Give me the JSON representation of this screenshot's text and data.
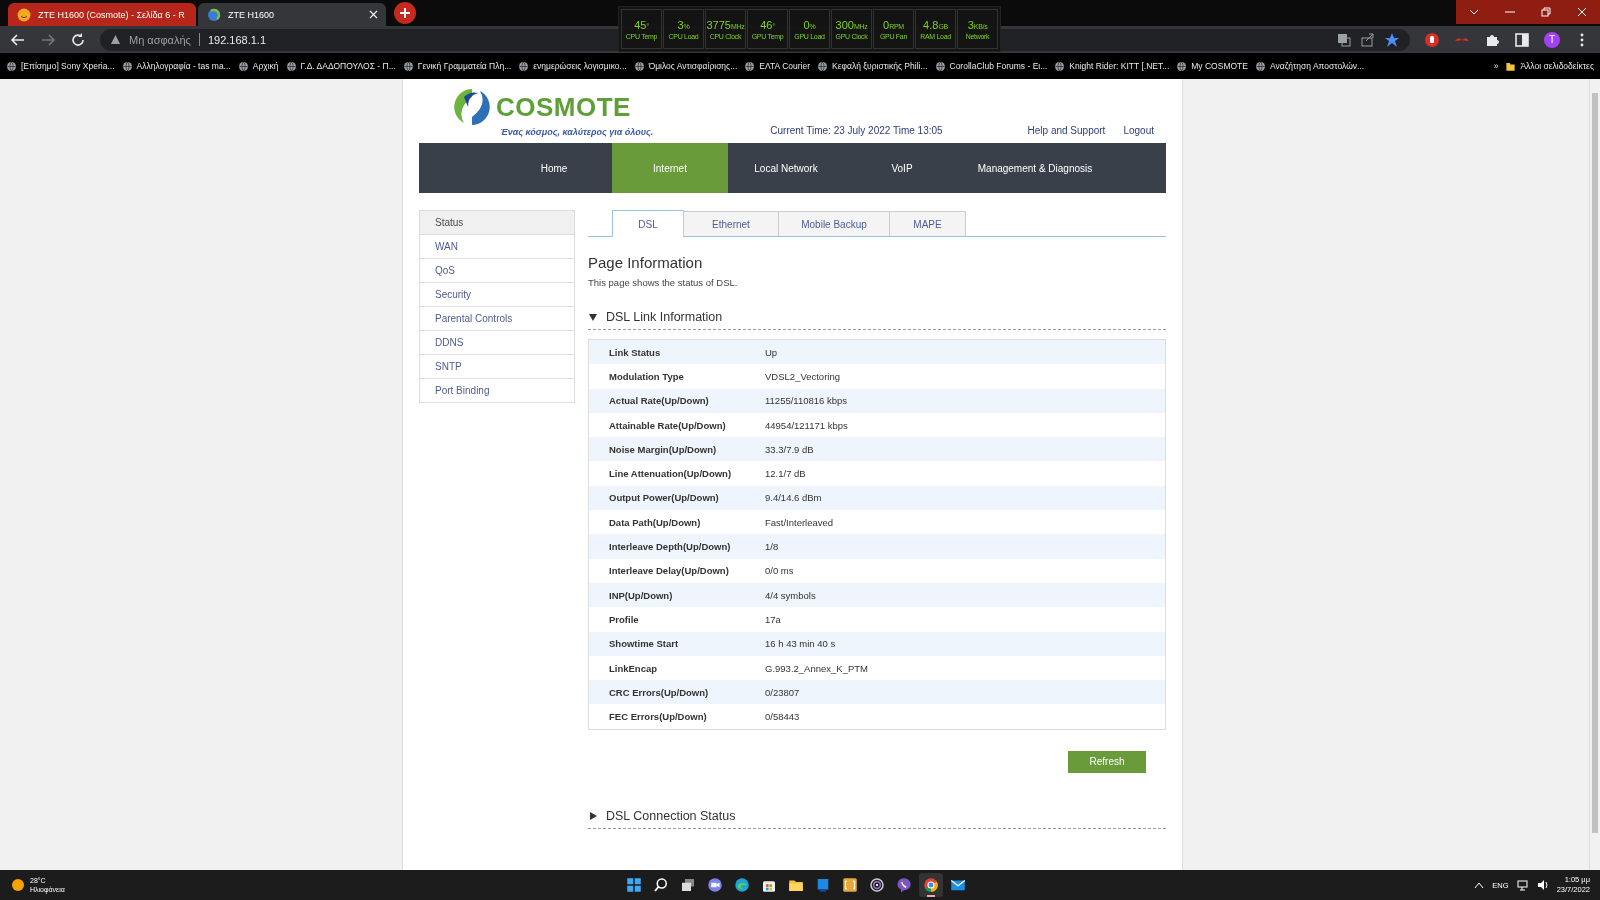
{
  "browser": {
    "tabs": [
      {
        "title": "ZTE H1600 (Cosmote) - Σελίδα 6 - R",
        "selected": false,
        "kind": "forum"
      },
      {
        "title": "ZTE H1600",
        "selected": true,
        "kind": "router"
      }
    ],
    "address": {
      "security": "Μη ασφαλής",
      "url": "192.168.1.1"
    },
    "bookmarks": [
      {
        "label": "[Επίσημο] Sony Xperia..."
      },
      {
        "label": "Αλληλογραφία - tas ma..."
      },
      {
        "label": "Αρχική"
      },
      {
        "label": "Γ.Δ. ΔΑΔΟΠΟΥΛΟΣ - Π..."
      },
      {
        "label": "Γενική Γραμματεία Πλη..."
      },
      {
        "label": "ενημερώσεις λογισμικο..."
      },
      {
        "label": "Όμιλος Αντισφαίρισης..."
      },
      {
        "label": "ΕΛΤΑ Courier"
      },
      {
        "label": "Κεφαλή ξυριστικής Phili..."
      },
      {
        "label": "CorollaClub Forums - Ει..."
      },
      {
        "label": "Knight Rider: KITT [.NET..."
      },
      {
        "label": "My COSMOTE"
      },
      {
        "label": "Αναζήτηση Αποστολών..."
      }
    ],
    "overflow": "»",
    "other_bookmarks": "Άλλοι σελιδοδείκτες",
    "profile_initial": "T"
  },
  "hw_monitor": [
    {
      "value": "45",
      "unit": "°",
      "label": "CPU Temp"
    },
    {
      "value": "3",
      "unit": "%",
      "label": "CPU Load"
    },
    {
      "value": "3775",
      "unit": "MHz",
      "label": "CPU Clock"
    },
    {
      "value": "46",
      "unit": "°",
      "label": "GPU Temp"
    },
    {
      "value": "0",
      "unit": "%",
      "label": "GPU Load"
    },
    {
      "value": "300",
      "unit": "MHz",
      "label": "GPU Clock"
    },
    {
      "value": "0",
      "unit": "RPM",
      "label": "GPU Fan"
    },
    {
      "value": "4.8",
      "unit": "GB",
      "label": "RAM Load"
    },
    {
      "value": "3",
      "unit": "KB/s",
      "label": "Network"
    }
  ],
  "page": {
    "logo": {
      "brand": "COSMOTE",
      "tagline": "Ένας κόσμος, καλύτερος για όλους."
    },
    "current_time": "Current Time: 23 July 2022 Time 13:05",
    "header_links": [
      "Help and Support",
      "Logout"
    ],
    "nav": [
      {
        "label": "Home",
        "selected": false
      },
      {
        "label": "Internet",
        "selected": true
      },
      {
        "label": "Local Network",
        "selected": false
      },
      {
        "label": "VoIP",
        "selected": false
      },
      {
        "label": "Management & Diagnosis",
        "selected": false
      }
    ],
    "sidebar": [
      {
        "label": "Status",
        "selected": true
      },
      {
        "label": "WAN",
        "selected": false
      },
      {
        "label": "QoS",
        "selected": false
      },
      {
        "label": "Security",
        "selected": false
      },
      {
        "label": "Parental Controls",
        "selected": false
      },
      {
        "label": "DDNS",
        "selected": false
      },
      {
        "label": "SNTP",
        "selected": false
      },
      {
        "label": "Port Binding",
        "selected": false
      }
    ],
    "subtabs": [
      {
        "label": "DSL",
        "selected": true
      },
      {
        "label": "Ethernet",
        "selected": false
      },
      {
        "label": "Mobile Backup",
        "selected": false
      },
      {
        "label": "MAPE",
        "selected": false
      }
    ],
    "heading": "Page Information",
    "description": "This page shows the status of DSL.",
    "sections": [
      {
        "title": "DSL Link Information",
        "expanded": true,
        "rows": [
          {
            "label": "Link Status",
            "value": "Up"
          },
          {
            "label": "Modulation Type",
            "value": "VDSL2_Vectoring"
          },
          {
            "label": "Actual Rate(Up/Down)",
            "value": "11255/110816 kbps"
          },
          {
            "label": "Attainable Rate(Up/Down)",
            "value": "44954/121171 kbps"
          },
          {
            "label": "Noise Margin(Up/Down)",
            "value": "33.3/7.9 dB"
          },
          {
            "label": "Line Attenuation(Up/Down)",
            "value": "12.1/7 dB"
          },
          {
            "label": "Output Power(Up/Down)",
            "value": "9.4/14.6 dBm"
          },
          {
            "label": "Data Path(Up/Down)",
            "value": "Fast/Interleaved"
          },
          {
            "label": "Interleave Depth(Up/Down)",
            "value": "1/8"
          },
          {
            "label": "Interleave Delay(Up/Down)",
            "value": "0/0 ms"
          },
          {
            "label": "INP(Up/Down)",
            "value": "4/4 symbols"
          },
          {
            "label": "Profile",
            "value": "17a"
          },
          {
            "label": "Showtime Start",
            "value": "16 h 43 min 40 s"
          },
          {
            "label": "LinkEncap",
            "value": "G.993.2_Annex_K_PTM"
          },
          {
            "label": "CRC Errors(Up/Down)",
            "value": "0/23807"
          },
          {
            "label": "FEC Errors(Up/Down)",
            "value": "0/58443"
          }
        ],
        "button": "Refresh"
      },
      {
        "title": "DSL Connection Status",
        "expanded": false
      }
    ]
  },
  "taskbar": {
    "weather": {
      "temp": "28°C",
      "condition": "Ηλιοφάνεια"
    },
    "apps": [
      {
        "kind": "start",
        "active": false
      },
      {
        "kind": "search",
        "active": false
      },
      {
        "kind": "taskview",
        "active": false
      },
      {
        "kind": "chat",
        "active": false
      },
      {
        "kind": "edge",
        "active": false
      },
      {
        "kind": "store",
        "active": false
      },
      {
        "kind": "folder",
        "active": false
      },
      {
        "kind": "blue",
        "active": false
      },
      {
        "kind": "yellow",
        "active": false
      },
      {
        "kind": "ring",
        "active": false
      },
      {
        "kind": "viber",
        "active": false
      },
      {
        "kind": "chrome",
        "active": true
      },
      {
        "kind": "mail",
        "active": false
      }
    ],
    "tray": {
      "lang": "ENG",
      "time": "1:05 μμ",
      "date": "23/7/2022"
    }
  }
}
